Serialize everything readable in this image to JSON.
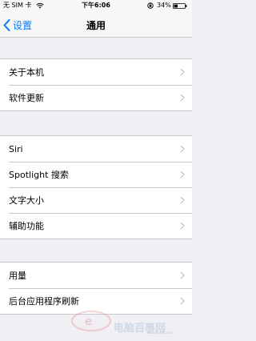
{
  "status_bar": {
    "carrier": "无 SIM 卡",
    "time": "下午6:06",
    "battery_percent": "34%"
  },
  "nav": {
    "back_label": "设置",
    "title": "通用"
  },
  "groups": [
    {
      "items": [
        {
          "label": "关于本机"
        },
        {
          "label": "软件更新"
        }
      ]
    },
    {
      "items": [
        {
          "label": "Siri"
        },
        {
          "label": "Spotlight 搜索"
        },
        {
          "label": "文字大小"
        },
        {
          "label": "辅助功能"
        }
      ]
    },
    {
      "items": [
        {
          "label": "用量"
        },
        {
          "label": "后台应用程序刷新"
        }
      ]
    }
  ],
  "watermark": {
    "text": "电脑百事网",
    "sub": "www.pc841.com"
  },
  "colors": {
    "accent": "#007aff",
    "background": "#efeff4",
    "separator": "#c8c7cc",
    "chevron": "#c7c7cc"
  }
}
